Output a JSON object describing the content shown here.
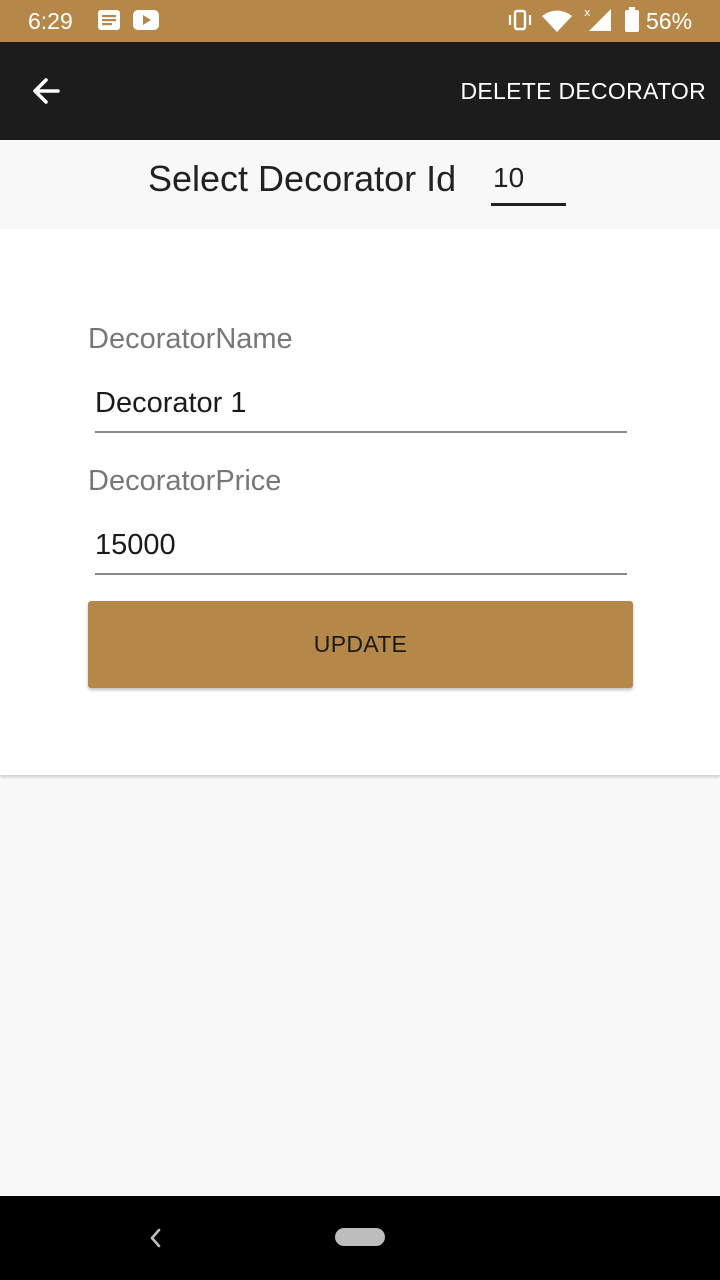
{
  "status_bar": {
    "time": "6:29",
    "battery": "56%",
    "background_color": "#b5884a",
    "icons": [
      "message-icon",
      "youtube-icon",
      "vibrate-icon",
      "wifi-icon",
      "signal-icon",
      "battery-icon"
    ]
  },
  "app_bar": {
    "back_icon": "arrow-left-icon",
    "action_label": "DELETE DECORATOR"
  },
  "selector": {
    "label": "Select Decorator Id",
    "value": "10"
  },
  "form": {
    "name_label": "DecoratorName",
    "name_value": "Decorator 1",
    "price_label": "DecoratorPrice",
    "price_value": "15000",
    "update_label": "UPDATE"
  },
  "nav_bar": {
    "icons": [
      "nav-back-icon",
      "nav-home-pill"
    ]
  }
}
